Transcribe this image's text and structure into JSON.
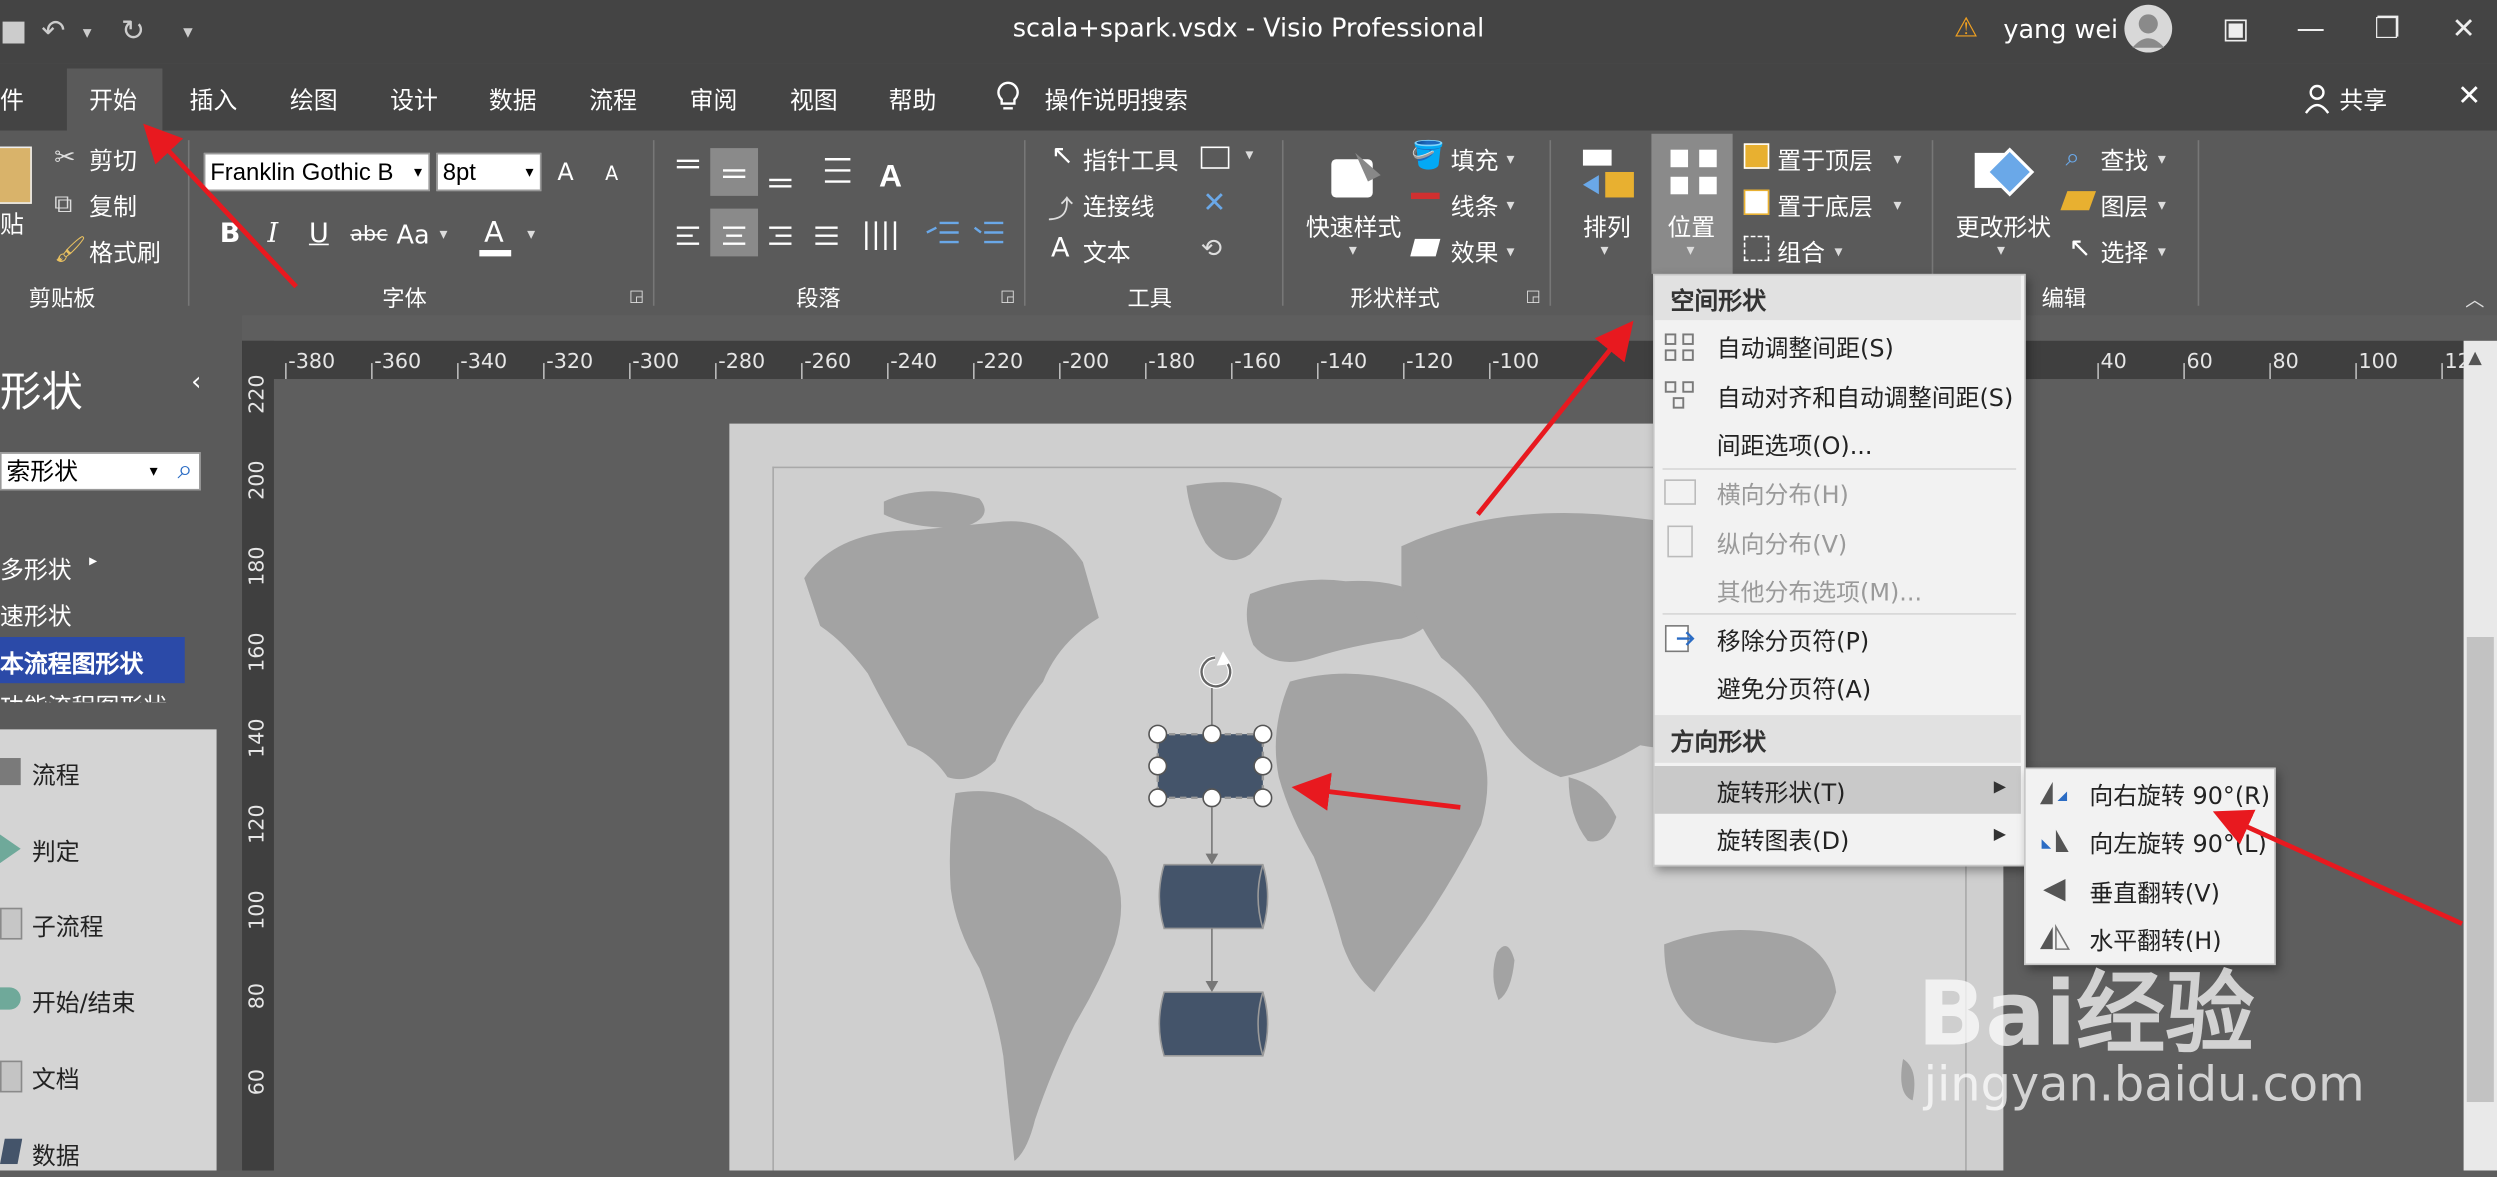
{
  "window": {
    "title": "scala+spark.vsdx  -  Visio Professional",
    "user_name": "yang wei"
  },
  "tabs": [
    "件",
    "开始",
    "插入",
    "绘图",
    "设计",
    "数据",
    "流程",
    "审阅",
    "视图",
    "帮助"
  ],
  "tell_me": "操作说明搜索",
  "share": "共享",
  "ribbon": {
    "clipboard": {
      "paste": "贴",
      "cut": "剪切",
      "copy": "复制",
      "format_painter": "格式刷",
      "group": "剪贴板"
    },
    "font": {
      "family": "Franklin Gothic B",
      "size": "8pt",
      "grow": "A",
      "shrink": "A",
      "bold": "B",
      "italic": "I",
      "underline": "U",
      "strike": "abc",
      "case": "Aa",
      "color": "A",
      "group": "字体"
    },
    "paragraph": {
      "group": "段落"
    },
    "tools": {
      "pointer": "指针工具",
      "connector": "连接线",
      "text": "文本",
      "text_icon": "A",
      "group": "工具"
    },
    "shape_styles": {
      "quick": "快速样式",
      "fill": "填充",
      "line": "线条",
      "effects": "效果",
      "group": "形状样式"
    },
    "arrange": {
      "arrange": "排列",
      "position": "位置",
      "bring_front": "置于顶层",
      "send_back": "置于底层",
      "group_btn": "组合"
    },
    "editing": {
      "change_shape": "更改形状",
      "find": "查找",
      "layers": "图层",
      "select": "选择",
      "group": "编辑"
    }
  },
  "ruler": {
    "h_ticks": [
      "-380",
      "-360",
      "-340",
      "-320",
      "-300",
      "-280",
      "-260",
      "-240",
      "-220",
      "-200",
      "-180",
      "-160",
      "-140",
      "-120",
      "-100",
      "40",
      "60",
      "80",
      "100",
      "12"
    ],
    "v_ticks": [
      "220",
      "200",
      "180",
      "160",
      "140",
      "120",
      "100",
      "80",
      "60"
    ]
  },
  "left_panel": {
    "title": "形状",
    "search": "索形状",
    "links": [
      "多形状",
      "速形状",
      "本流程图形状",
      "功能流程图形状"
    ],
    "shapes": [
      "流程",
      "判定",
      "子流程",
      "开始/结束",
      "文档",
      "数据"
    ]
  },
  "position_menu": {
    "section1": "空间形状",
    "items1": [
      {
        "label": "自动调整间距(S)",
        "enabled": true
      },
      {
        "label": "自动对齐和自动调整间距(S)",
        "enabled": true
      },
      {
        "label": "间距选项(O)...",
        "enabled": true
      }
    ],
    "items2": [
      {
        "label": "横向分布(H)",
        "enabled": false
      },
      {
        "label": "纵向分布(V)",
        "enabled": false
      },
      {
        "label": "其他分布选项(M)...",
        "enabled": false
      }
    ],
    "items3": [
      {
        "label": "移除分页符(P)",
        "enabled": true
      },
      {
        "label": "避免分页符(A)",
        "enabled": true
      }
    ],
    "section2": "方向形状",
    "items4": [
      {
        "label": "旋转形状(T)",
        "enabled": true
      },
      {
        "label": "旋转图表(D)",
        "enabled": true
      }
    ]
  },
  "rotate_submenu": [
    "向右旋转 90°(R)",
    "向左旋转 90°(L)",
    "垂直翻转(V)",
    "水平翻转(H)"
  ],
  "watermark": {
    "logo": "Bai经验",
    "url": "jingyan.baidu.com"
  },
  "colors": {
    "accent_red": "#e8191f",
    "shape_fill": "#44546a",
    "selected_nav": "#2b4aa8"
  }
}
